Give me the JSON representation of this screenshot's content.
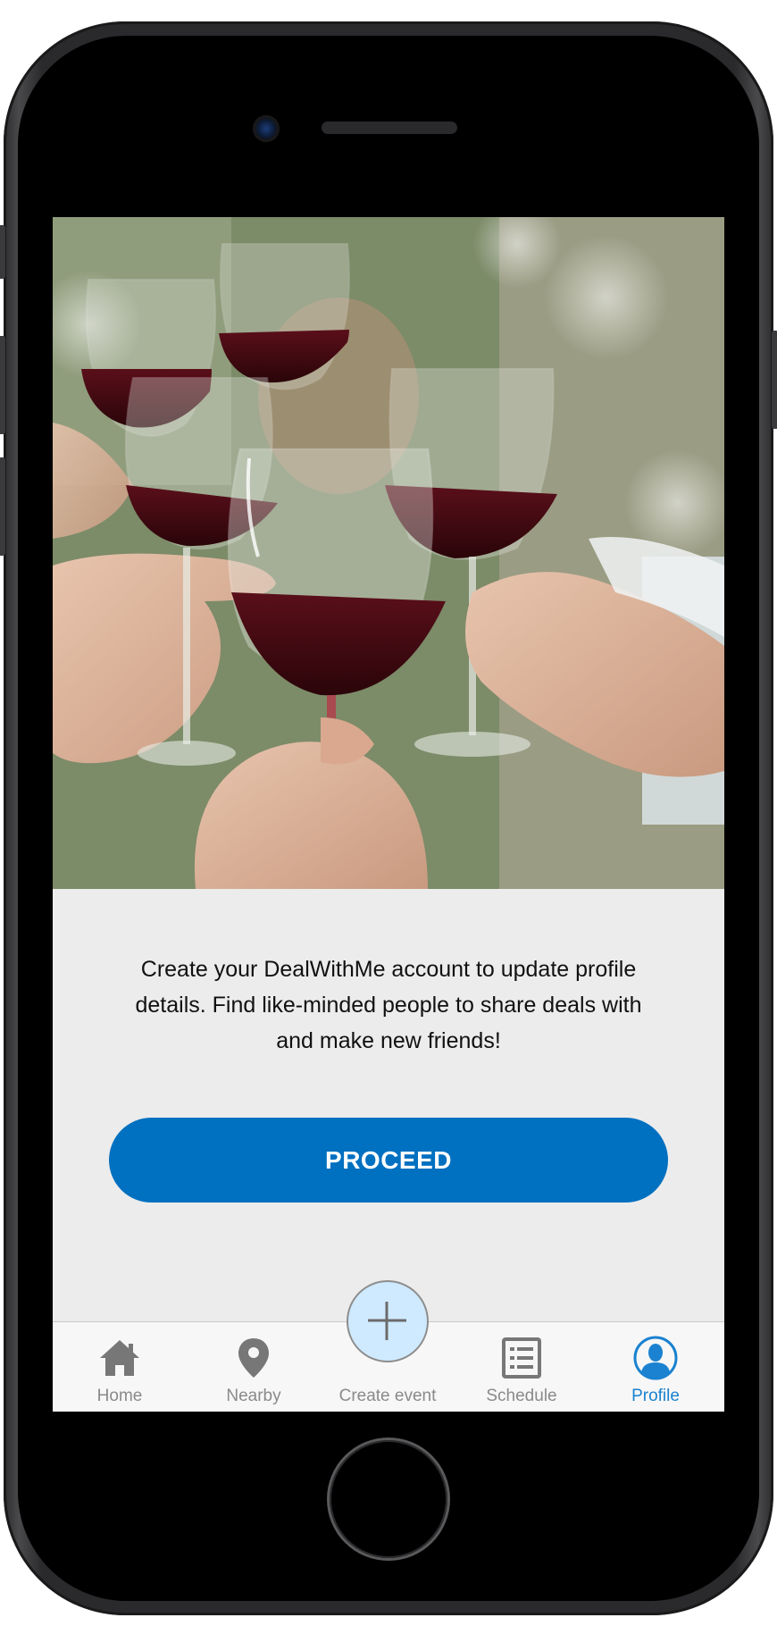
{
  "hero": {
    "image_description": "people toasting with red wine glasses"
  },
  "message": {
    "text": "Create your DealWithMe account to update profile details. Find like-minded people to share deals with and make new friends!"
  },
  "proceed_button": {
    "label": "PROCEED"
  },
  "colors": {
    "primary": "#0070C0",
    "tab_active": "#1A82D0",
    "tab_inactive": "#8A8A8A",
    "fab_fill": "#CFEAFF",
    "screen_background": "#ECECEC"
  },
  "tabbar": {
    "items": [
      {
        "label": "Home",
        "icon": "house-icon",
        "active": false
      },
      {
        "label": "Nearby",
        "icon": "map-pin-icon",
        "active": false
      },
      {
        "label": "Create event",
        "icon": "plus-icon",
        "active": false
      },
      {
        "label": "Schedule",
        "icon": "list-icon",
        "active": false
      },
      {
        "label": "Profile",
        "icon": "person-icon",
        "active": true
      }
    ]
  }
}
